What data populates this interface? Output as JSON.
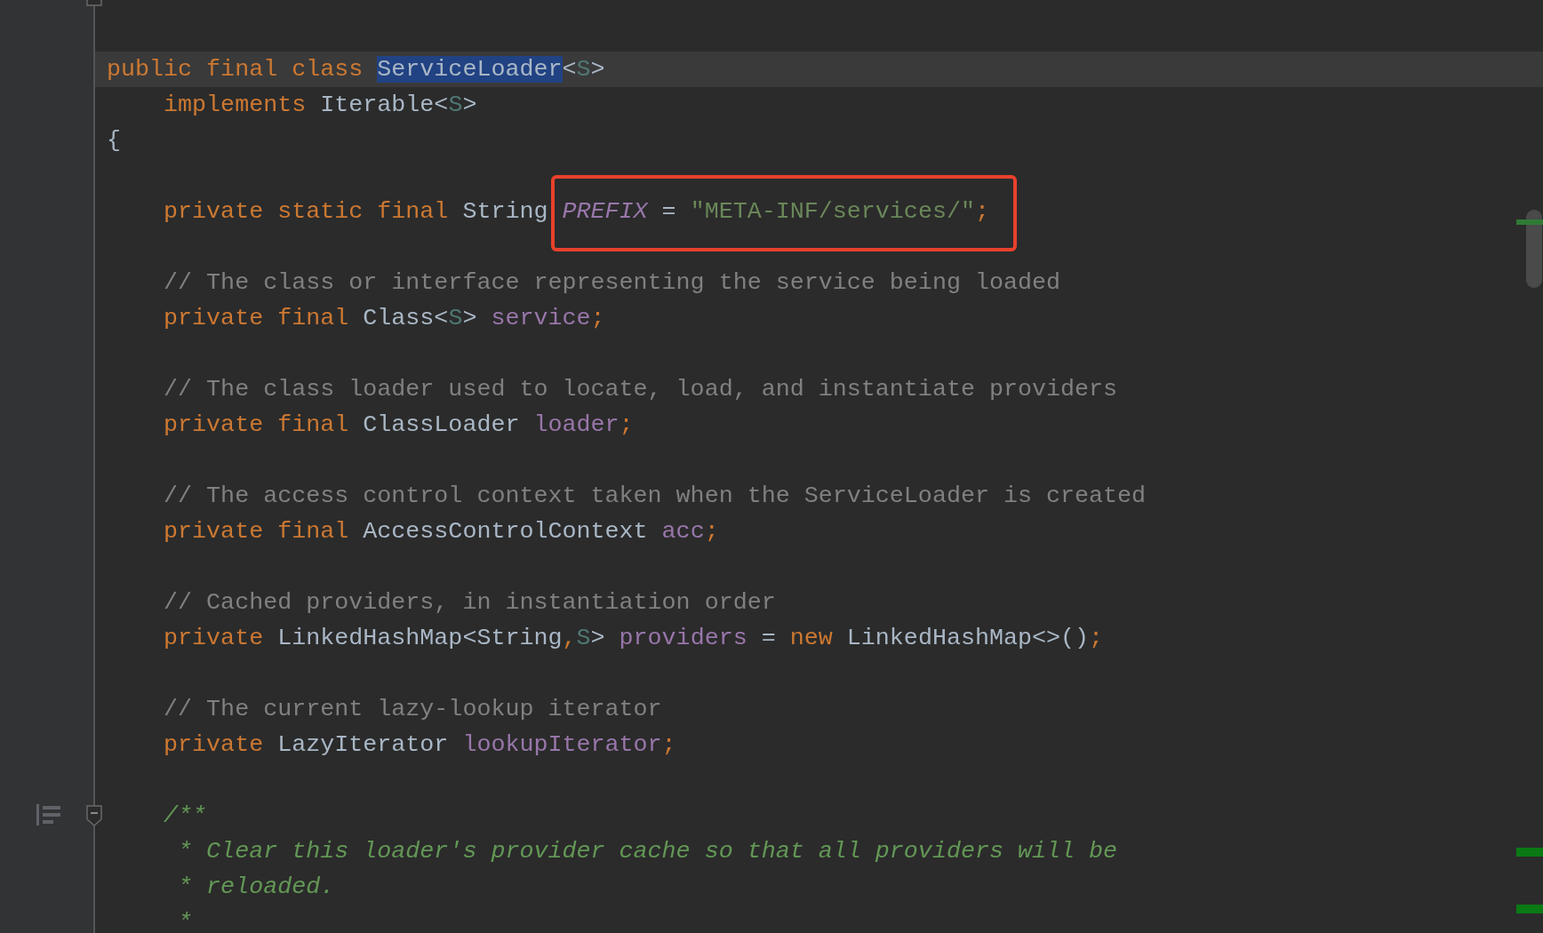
{
  "editor": {
    "lines": [
      {
        "kind": "blank",
        "fold_end": true
      },
      {
        "kind": "blank"
      },
      {
        "kind": "code",
        "current": true,
        "tokens": [
          {
            "text": "public final class ",
            "kind": "keyword"
          },
          {
            "text": "ServiceLoader",
            "kind": "plain",
            "highlight": true
          },
          {
            "text": "<",
            "kind": "plain"
          },
          {
            "text": "S",
            "kind": "typeparam"
          },
          {
            "text": ">",
            "kind": "plain"
          }
        ]
      },
      {
        "kind": "code",
        "tokens": [
          {
            "text": "    implements ",
            "kind": "keyword"
          },
          {
            "text": "Iterable<",
            "kind": "plain"
          },
          {
            "text": "S",
            "kind": "typeparam"
          },
          {
            "text": ">",
            "kind": "plain"
          }
        ]
      },
      {
        "kind": "code",
        "tokens": [
          {
            "text": "{",
            "kind": "plain"
          }
        ]
      },
      {
        "kind": "blank"
      },
      {
        "kind": "code",
        "tokens": [
          {
            "text": "    private static final ",
            "kind": "keyword"
          },
          {
            "text": "String ",
            "kind": "plain"
          },
          {
            "text": "PREFIX",
            "kind": "static",
            "boxed": true
          },
          {
            "text": " = ",
            "kind": "plain",
            "boxed": true
          },
          {
            "text": "\"META-INF/services/\"",
            "kind": "string",
            "boxed": true
          },
          {
            "text": ";",
            "kind": "keyword",
            "boxed": true
          }
        ]
      },
      {
        "kind": "blank"
      },
      {
        "kind": "code",
        "tokens": [
          {
            "text": "    // The class or interface representing the service being loaded",
            "kind": "comment"
          }
        ]
      },
      {
        "kind": "code",
        "tokens": [
          {
            "text": "    private final ",
            "kind": "keyword"
          },
          {
            "text": "Class<",
            "kind": "plain"
          },
          {
            "text": "S",
            "kind": "typeparam"
          },
          {
            "text": "> ",
            "kind": "plain"
          },
          {
            "text": "service",
            "kind": "field"
          },
          {
            "text": ";",
            "kind": "keyword"
          }
        ]
      },
      {
        "kind": "blank"
      },
      {
        "kind": "code",
        "tokens": [
          {
            "text": "    // The class loader used to locate, load, and instantiate providers",
            "kind": "comment"
          }
        ]
      },
      {
        "kind": "code",
        "tokens": [
          {
            "text": "    private final ",
            "kind": "keyword"
          },
          {
            "text": "ClassLoader ",
            "kind": "plain"
          },
          {
            "text": "loader",
            "kind": "field"
          },
          {
            "text": ";",
            "kind": "keyword"
          }
        ]
      },
      {
        "kind": "blank"
      },
      {
        "kind": "code",
        "tokens": [
          {
            "text": "    // The access control context taken when the ServiceLoader is created",
            "kind": "comment"
          }
        ]
      },
      {
        "kind": "code",
        "tokens": [
          {
            "text": "    private final ",
            "kind": "keyword"
          },
          {
            "text": "AccessControlContext ",
            "kind": "plain"
          },
          {
            "text": "acc",
            "kind": "field"
          },
          {
            "text": ";",
            "kind": "keyword"
          }
        ]
      },
      {
        "kind": "blank"
      },
      {
        "kind": "code",
        "tokens": [
          {
            "text": "    // Cached providers, in instantiation order",
            "kind": "comment"
          }
        ]
      },
      {
        "kind": "code",
        "tokens": [
          {
            "text": "    private ",
            "kind": "keyword"
          },
          {
            "text": "LinkedHashMap<String",
            "kind": "plain"
          },
          {
            "text": ",",
            "kind": "keyword"
          },
          {
            "text": "S",
            "kind": "typeparam"
          },
          {
            "text": "> ",
            "kind": "plain"
          },
          {
            "text": "providers",
            "kind": "field"
          },
          {
            "text": " = ",
            "kind": "plain"
          },
          {
            "text": "new ",
            "kind": "keyword"
          },
          {
            "text": "LinkedHashMap<>()",
            "kind": "plain"
          },
          {
            "text": ";",
            "kind": "keyword"
          }
        ]
      },
      {
        "kind": "blank"
      },
      {
        "kind": "code",
        "tokens": [
          {
            "text": "    // The current lazy-lookup iterator",
            "kind": "comment"
          }
        ]
      },
      {
        "kind": "code",
        "tokens": [
          {
            "text": "    private ",
            "kind": "keyword"
          },
          {
            "text": "LazyIterator ",
            "kind": "plain"
          },
          {
            "text": "lookupIterator",
            "kind": "field"
          },
          {
            "text": ";",
            "kind": "keyword"
          }
        ]
      },
      {
        "kind": "blank"
      },
      {
        "kind": "code",
        "fold_start": true,
        "doc_icon": true,
        "tokens": [
          {
            "text": "    /**",
            "kind": "doc"
          }
        ]
      },
      {
        "kind": "code",
        "tokens": [
          {
            "text": "     * Clear this loader's provider cache so that all providers will be",
            "kind": "doc"
          }
        ]
      },
      {
        "kind": "code",
        "tokens": [
          {
            "text": "     * reloaded.",
            "kind": "doc"
          }
        ]
      },
      {
        "kind": "code",
        "tokens": [
          {
            "text": "     *",
            "kind": "doc"
          }
        ]
      }
    ]
  }
}
